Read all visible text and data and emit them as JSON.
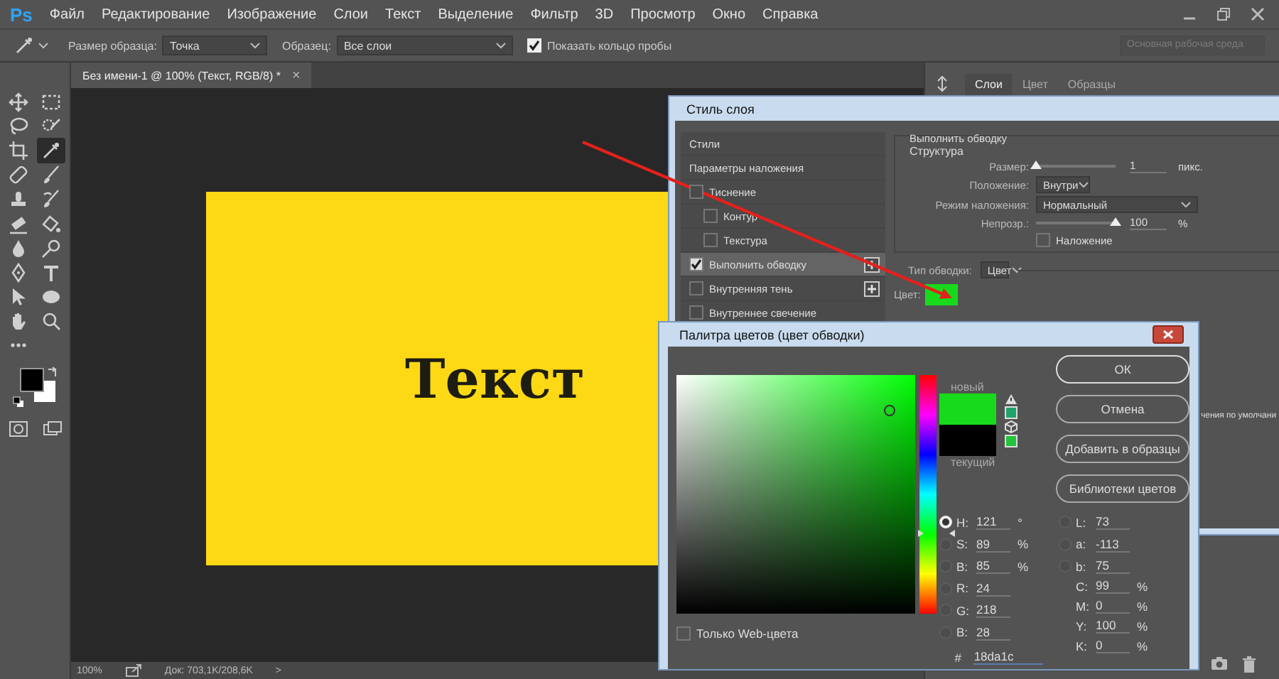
{
  "app": {
    "logo": "Ps"
  },
  "menu": [
    "Файл",
    "Редактирование",
    "Изображение",
    "Слои",
    "Текст",
    "Выделение",
    "Фильтр",
    "3D",
    "Просмотр",
    "Окно",
    "Справка"
  ],
  "options": {
    "sample_size_label": "Размер образца:",
    "sample_size": "Точка",
    "sample_label": "Образец:",
    "sample": "Все слои",
    "show_ring": {
      "label": "Показать кольцо пробы",
      "checked": true
    },
    "workspace": "Основная рабочая среда"
  },
  "tools": [
    {
      "kind": "move",
      "selected": false
    },
    {
      "kind": "marquee",
      "selected": false
    },
    {
      "kind": "lasso",
      "selected": false
    },
    {
      "kind": "quick-select",
      "selected": false
    },
    {
      "kind": "crop",
      "selected": false
    },
    {
      "kind": "eyedropper",
      "selected": true
    },
    {
      "kind": "healing",
      "selected": false
    },
    {
      "kind": "brush",
      "selected": false
    },
    {
      "kind": "stamp",
      "selected": false
    },
    {
      "kind": "history-brush",
      "selected": false
    },
    {
      "kind": "eraser",
      "selected": false
    },
    {
      "kind": "bucket",
      "selected": false
    },
    {
      "kind": "blur",
      "selected": false
    },
    {
      "kind": "dodge",
      "selected": false
    },
    {
      "kind": "pen",
      "selected": false
    },
    {
      "kind": "type",
      "selected": false
    },
    {
      "kind": "path-select",
      "selected": false
    },
    {
      "kind": "ellipse",
      "selected": false
    },
    {
      "kind": "hand",
      "selected": false
    },
    {
      "kind": "zoom",
      "selected": false
    },
    {
      "kind": "more",
      "selected": false
    }
  ],
  "colors": {
    "foreground": {
      "color": "#000000"
    },
    "background": {
      "color": "#ffffff"
    }
  },
  "document_tab": {
    "title": "Без имени-1 @ 100% (Текст, RGB/8) *",
    "close": "×"
  },
  "canvas": {
    "text": "Текст"
  },
  "status_bar": {
    "zoom": "100%",
    "doc": "Док: 703,1K/208,6K",
    "arrow": ">"
  },
  "panel": {
    "tabs": [
      {
        "label": "Слои",
        "selected": true
      },
      {
        "label": "Цвет",
        "selected": false
      },
      {
        "label": "Образцы",
        "selected": false
      }
    ]
  },
  "layer_style": {
    "title": "Стиль слоя",
    "styles": [
      {
        "kind": "header",
        "label": "Стили",
        "selected": false
      },
      {
        "kind": "header",
        "label": "Параметры наложения",
        "selected": false
      },
      {
        "kind": "check",
        "label": "Тиснение",
        "checked": false,
        "selected": false,
        "add": false
      },
      {
        "kind": "sub",
        "label": "Контур",
        "checked": false,
        "selected": false,
        "add": false
      },
      {
        "kind": "sub",
        "label": "Текстура",
        "checked": false,
        "selected": false,
        "add": false
      },
      {
        "kind": "check",
        "label": "Выполнить обводку",
        "checked": true,
        "selected": true,
        "add": true
      },
      {
        "kind": "check",
        "label": "Внутренняя тень",
        "checked": false,
        "selected": false,
        "add": true
      },
      {
        "kind": "check",
        "label": "Внутреннее свечение",
        "checked": false,
        "selected": false,
        "add": false
      }
    ],
    "stroke": {
      "section": "Выполнить обводку",
      "group": "Структура",
      "size": {
        "label": "Размер:",
        "value": "1",
        "unit": "пикс.",
        "level": 0
      },
      "position": {
        "label": "Положение:",
        "value": "Внутри"
      },
      "blend": {
        "label": "Режим наложения:",
        "value": "Нормальный"
      },
      "opacity": {
        "label": "Непрозр.:",
        "value": "100",
        "unit": "%",
        "level": 1
      },
      "overprint": {
        "label": "Наложение",
        "checked": false
      },
      "fill_type": {
        "label": "Тип обводки:",
        "value": "Цвет"
      },
      "color": {
        "label": "Цвет:",
        "color": "#18da1c"
      },
      "defaults_button": "чения по умолчани"
    }
  },
  "color_picker": {
    "title": "Палитра цветов (цвет обводки)",
    "hue": {
      "level": 0.336
    },
    "field_x": {
      "level": 0.89
    },
    "field_y": {
      "level": 0.85
    },
    "new_label": "новый",
    "current_label": "текущий",
    "new": {
      "color": "#18da1c"
    },
    "current": {
      "color": "#000000"
    },
    "gamut_swatch": {
      "color": "#1fa56b"
    },
    "web_swatch": {
      "color": "#22c43a"
    },
    "buttons": [
      "ОК",
      "Отмена",
      "Добавить в образцы",
      "Библиотеки цветов"
    ],
    "hsb_rgb": [
      {
        "label": "H:",
        "value": "121",
        "unit": "°",
        "selected": true
      },
      {
        "label": "S:",
        "value": "89",
        "unit": "%",
        "selected": false
      },
      {
        "label": "B:",
        "value": "85",
        "unit": "%",
        "selected": false
      },
      {
        "label": "R:",
        "value": "24",
        "selected": false
      },
      {
        "label": "G:",
        "value": "218",
        "selected": false
      },
      {
        "label": "B:",
        "value": "28",
        "selected": false
      }
    ],
    "lab": [
      {
        "label": "L:",
        "value": "73",
        "selected": false
      },
      {
        "label": "a:",
        "value": "-113",
        "selected": false
      },
      {
        "label": "b:",
        "value": "75",
        "selected": false
      }
    ],
    "cmyk": [
      {
        "label": "C:",
        "value": "99",
        "unit": "%"
      },
      {
        "label": "M:",
        "value": "0",
        "unit": "%"
      },
      {
        "label": "Y:",
        "value": "100",
        "unit": "%"
      },
      {
        "label": "K:",
        "value": "0",
        "unit": "%"
      }
    ],
    "hex": {
      "label": "#",
      "value": "18da1c"
    },
    "web_only": {
      "label": "Только Web-цвета",
      "checked": false
    }
  }
}
